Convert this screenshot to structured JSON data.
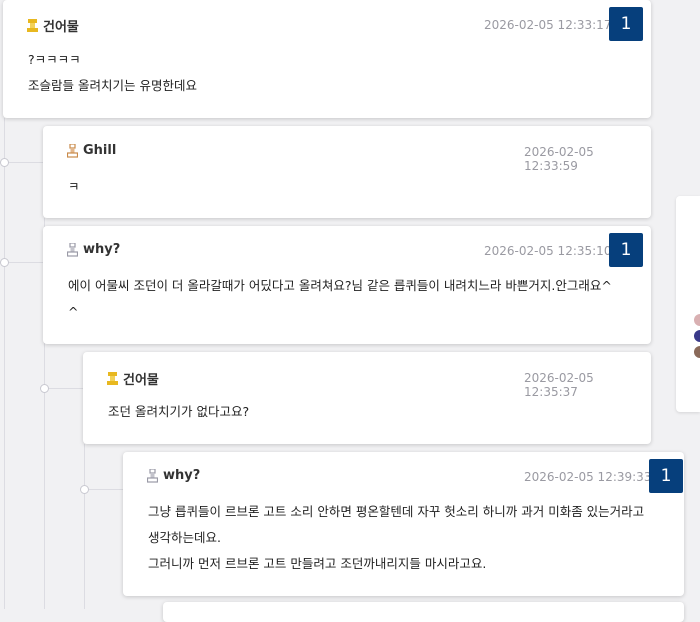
{
  "comments": [
    {
      "author": "건어물",
      "time": "2026-02-05 12:33:17",
      "badge": "1",
      "lines": [
        "?ㅋㅋㅋㅋ",
        "조슬람들 올려치기는 유명한데요"
      ],
      "icon": "gold-medal-icon"
    },
    {
      "author": "Ghill",
      "time": "2026-02-05 12:33:59",
      "lines": [
        "ㅋ"
      ],
      "icon": "bronze-medal-icon"
    },
    {
      "author": "why?",
      "time": "2026-02-05 12:35:10",
      "badge": "1",
      "lines": [
        "에이 어물씨 조던이 더 올라갈때가 어딨다고 올려쳐요?님 같은 릅퀴들이 내려치느라 바쁜거지.안그래요^",
        "^"
      ],
      "icon": "silver-medal-icon"
    },
    {
      "author": "건어물",
      "time": "2026-02-05 12:35:37",
      "lines": [
        "조던 올려치기가 없다고요?"
      ],
      "icon": "gold-medal-icon"
    },
    {
      "author": "why?",
      "time": "2026-02-05 12:39:33",
      "badge": "1",
      "lines": [
        "그냥 릅퀴들이 르브론 고트 소리 안하면 평온할텐데 자꾸 헛소리 하니까 과거 미화좀 있는거라고",
        "생각하는데요.",
        "그러니까 먼저 르브론 고트 만들려고 조던까내리지들 마시라고요."
      ],
      "icon": "silver-medal-icon"
    }
  ],
  "colors": {
    "badge": "#063f7c",
    "gold": "#e8b820",
    "bronze": "#c98a4a",
    "silver": "#9a9aa6"
  }
}
